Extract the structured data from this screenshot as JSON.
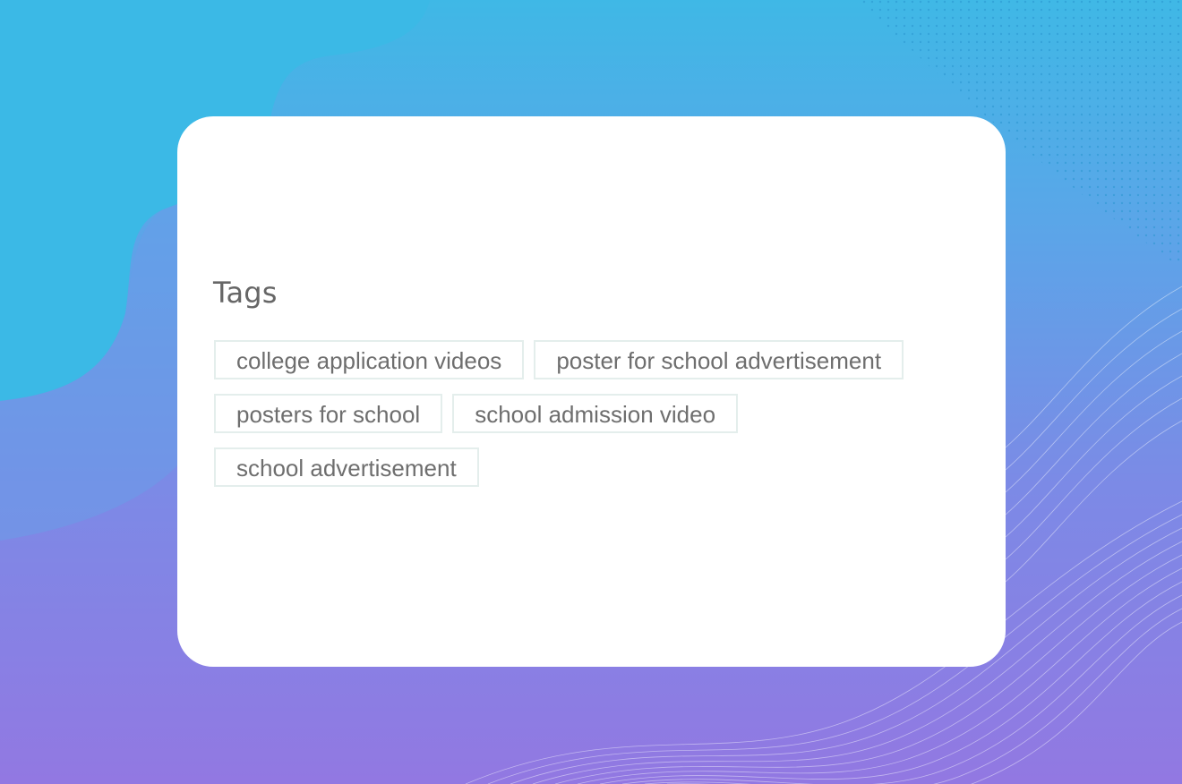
{
  "colors": {
    "background_top": "#3fb8e6",
    "background_bottom": "#9278e2",
    "card": "#ffffff",
    "tag_border": "#e4eeec",
    "tag_text": "#6e6e6e",
    "title_text": "#666666"
  },
  "section": {
    "title": "Tags"
  },
  "tags": [
    "college application videos",
    "poster for school advertisement",
    "posters for school",
    "school admission video",
    "school advertisement"
  ]
}
